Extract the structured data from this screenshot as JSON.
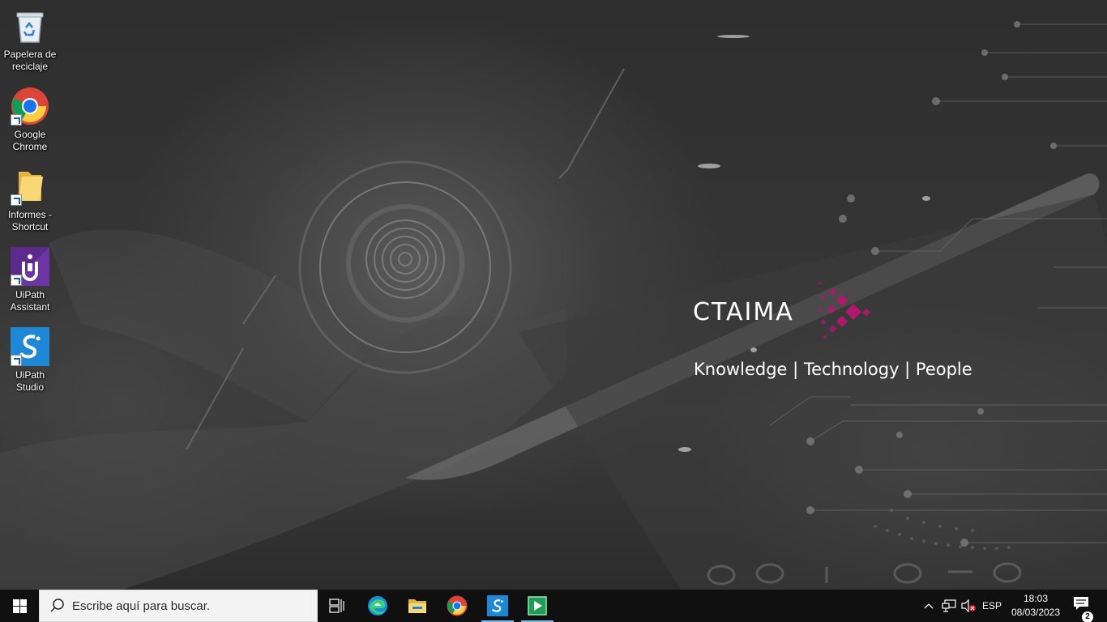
{
  "desktop": {
    "icons": [
      {
        "label": "Papelera de reciclaje",
        "icon": "recycle-bin-icon"
      },
      {
        "label": "Google Chrome",
        "icon": "chrome-icon"
      },
      {
        "label": "Informes - Shortcut",
        "icon": "folder-icon"
      },
      {
        "label": "UiPath Assistant",
        "icon": "uipath-assistant-icon"
      },
      {
        "label": "UiPath Studio",
        "icon": "uipath-studio-icon"
      }
    ]
  },
  "wallpaper": {
    "brand": "CTAIMA",
    "tagline": "Knowledge | Technology | People",
    "accent_color": "#b0186e"
  },
  "taskbar": {
    "search_placeholder": "Escribe aquí para buscar.",
    "apps": [
      "task-view-icon",
      "edge-icon",
      "file-explorer-icon",
      "chrome-icon",
      "uipath-studio-icon",
      "media-player-icon"
    ],
    "tray": {
      "language": "ESP",
      "time": "18:03",
      "date": "08/03/2023",
      "notifications": "2"
    }
  }
}
